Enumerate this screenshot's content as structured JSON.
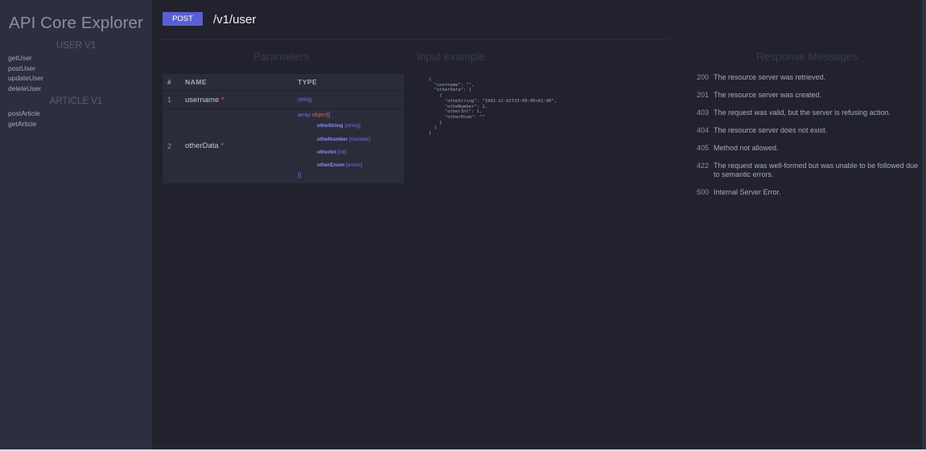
{
  "app": {
    "title": "API Core Explorer"
  },
  "sidebar": {
    "groups": [
      {
        "title": "USER V1",
        "items": [
          "getUser",
          "postUser",
          "updateUser",
          "deleteUser"
        ]
      },
      {
        "title": "ARTICLE V1",
        "items": [
          "postArticle",
          "getArticle"
        ]
      }
    ]
  },
  "endpoint": {
    "method": "POST",
    "path": "/v1/user",
    "method_color": "#5a5fd2"
  },
  "sections": {
    "parameters": "Parameters",
    "input_example": "Input example",
    "responses": "Response Messages"
  },
  "params_table": {
    "headers": {
      "num": "#",
      "name": "NAME",
      "type": "TYPE"
    },
    "rows": [
      {
        "num": "1",
        "name": "username",
        "required": "*",
        "type": "string"
      },
      {
        "num": "2",
        "name": "otherData",
        "required": "*",
        "type_prefix": "array",
        "type_object": "object",
        "type_open": "[{",
        "fields": [
          {
            "name": "otheString",
            "type": "[string]"
          },
          {
            "name": "otheNumber",
            "type": "[number]"
          },
          {
            "name": "otherInt",
            "type": "[int]"
          },
          {
            "name": "otherEnum",
            "type": "[enum]"
          }
        ],
        "type_close": "}]"
      }
    ]
  },
  "input_example": {
    "lines": [
      "{",
      "  \"username\": \"\",",
      "  \"otherData\": [",
      "    {",
      "      \"otheString\": \"1992-12-02T23:00:00+01:00\",",
      "      \"otheNumber\": 1,",
      "      \"otherInt\": 1,",
      "      \"otherEnum\": \"\"",
      "    }",
      "  ]",
      "}"
    ]
  },
  "responses": [
    {
      "code": "200",
      "message": "The resource server was retrieved."
    },
    {
      "code": "201",
      "message": "The resource server was created."
    },
    {
      "code": "403",
      "message": "The request was valid, but the server is refusing action."
    },
    {
      "code": "404",
      "message": "The resource server does not exist."
    },
    {
      "code": "405",
      "message": "Method not allowed."
    },
    {
      "code": "422",
      "message": "The request was well-formed but was unable to be followed due to semantic errors."
    },
    {
      "code": "500",
      "message": "Internal Server Error."
    }
  ]
}
